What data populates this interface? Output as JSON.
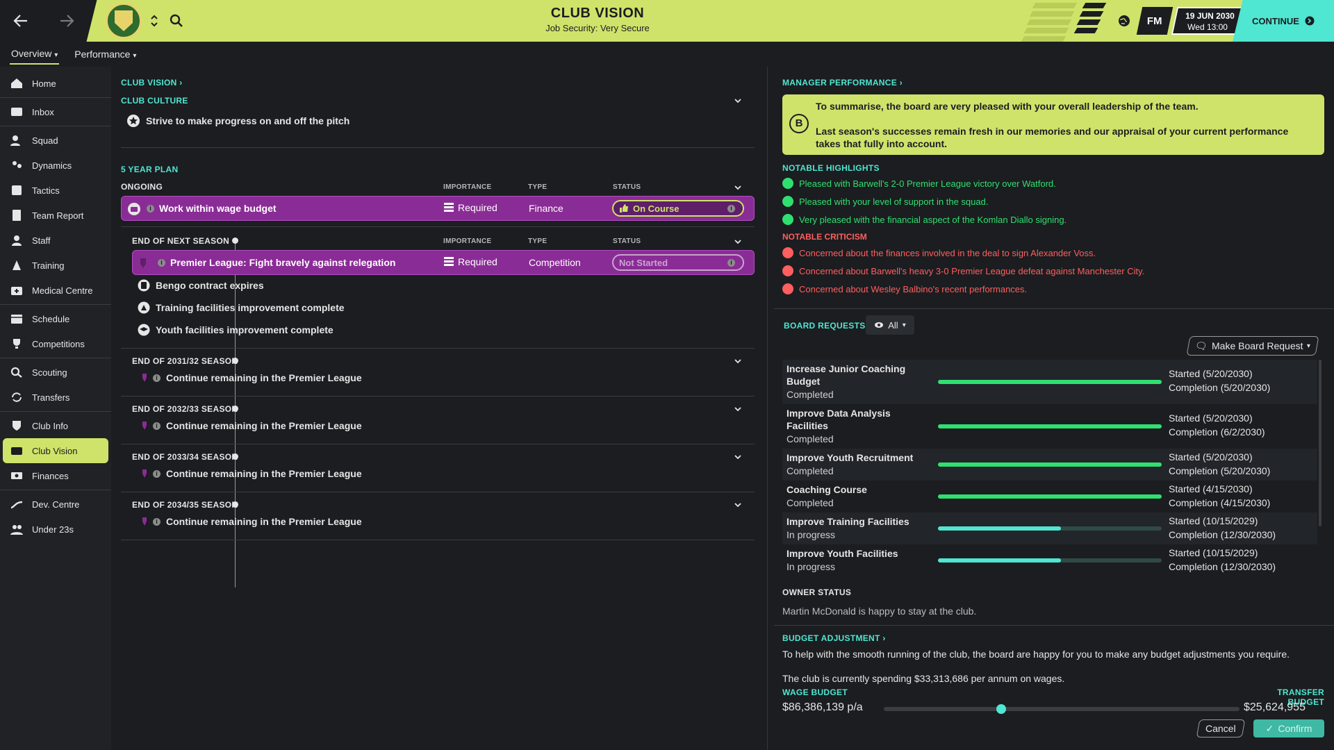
{
  "header": {
    "title": "CLUB VISION",
    "subtitle": "Job Security: Very Secure",
    "brand": "FM",
    "date": "19 JUN 2030",
    "time": "Wed 13:00",
    "continue_label": "CONTINUE"
  },
  "subnav": {
    "tabs": [
      {
        "label": "Overview"
      },
      {
        "label": "Performance"
      }
    ]
  },
  "sidebar": {
    "items": [
      {
        "label": "Home",
        "icon": "home-icon"
      },
      {
        "label": "Inbox",
        "icon": "inbox-icon"
      },
      {
        "label": "Squad",
        "icon": "squad-icon"
      },
      {
        "label": "Dynamics",
        "icon": "dynamics-icon"
      },
      {
        "label": "Tactics",
        "icon": "tactics-icon"
      },
      {
        "label": "Team Report",
        "icon": "report-icon"
      },
      {
        "label": "Staff",
        "icon": "staff-icon"
      },
      {
        "label": "Training",
        "icon": "training-icon"
      },
      {
        "label": "Medical Centre",
        "icon": "medical-icon"
      },
      {
        "label": "Schedule",
        "icon": "calendar-icon"
      },
      {
        "label": "Competitions",
        "icon": "trophy-icon"
      },
      {
        "label": "Scouting",
        "icon": "search-icon"
      },
      {
        "label": "Transfers",
        "icon": "transfer-icon"
      },
      {
        "label": "Club Info",
        "icon": "shield-icon"
      },
      {
        "label": "Club Vision",
        "icon": "vision-icon"
      },
      {
        "label": "Finances",
        "icon": "money-icon"
      },
      {
        "label": "Dev. Centre",
        "icon": "dev-icon"
      },
      {
        "label": "Under 23s",
        "icon": "u23-icon"
      }
    ]
  },
  "vision": {
    "link": "CLUB VISION",
    "culture_head": "CLUB CULTURE",
    "culture_item": "Strive to make progress on and off the pitch",
    "plan_head": "5 YEAR PLAN",
    "col_importance": "IMPORTANCE",
    "col_type": "TYPE",
    "col_status": "STATUS",
    "ongoing": {
      "head": "ONGOING",
      "goal": "Work within wage budget",
      "importance": "Required",
      "type": "Finance",
      "status": "On Course"
    },
    "next_season": {
      "head": "END OF NEXT SEASON",
      "goal": "Premier League: Fight bravely against relegation",
      "importance": "Required",
      "type": "Competition",
      "status": "Not Started",
      "tasks": [
        "Bengo contract expires",
        "Training facilities improvement complete",
        "Youth facilities improvement complete"
      ]
    },
    "seasons": [
      {
        "head": "END OF 2031/32 SEASON",
        "goal": "Continue remaining in the Premier League"
      },
      {
        "head": "END OF 2032/33 SEASON",
        "goal": "Continue remaining in the Premier League"
      },
      {
        "head": "END OF 2033/34 SEASON",
        "goal": "Continue remaining in the Premier League"
      },
      {
        "head": "END OF 2034/35 SEASON",
        "goal": "Continue remaining in the Premier League"
      }
    ]
  },
  "manager": {
    "link": "MANAGER PERFORMANCE",
    "grade": "B",
    "summary_1": "To summarise, the board are very pleased with your overall leadership of the team.",
    "summary_2": "Last season's successes remain fresh in our memories and our appraisal of your current performance",
    "summary_3": "takes that fully into account.",
    "highlights_head": "NOTABLE HIGHLIGHTS",
    "highlights": [
      "Pleased with Barwell's 2-0 Premier League victory over Watford.",
      "Pleased with your level of support in the squad.",
      "Very pleased with the financial aspect of the Komlan Diallo signing."
    ],
    "criticism_head": "NOTABLE CRITICISM",
    "criticism": [
      "Concerned about the finances involved in the deal to sign Alexander Voss.",
      "Concerned about Barwell's heavy 3-0 Premier League defeat against Manchester City.",
      "Concerned about Wesley Balbino's recent performances."
    ]
  },
  "board": {
    "head": "BOARD REQUESTS",
    "filter": "All",
    "make_request": "Make Board Request",
    "requests": [
      {
        "name": "Increase Junior Coaching Budget",
        "state": "Completed",
        "progress": 1.0,
        "started": "Started (5/20/2030)",
        "completion": "Completion (5/20/2030)"
      },
      {
        "name": "Improve Data Analysis Facilities",
        "state": "Completed",
        "progress": 1.0,
        "started": "Started (5/20/2030)",
        "completion": "Completion (6/2/2030)"
      },
      {
        "name": "Improve Youth Recruitment",
        "state": "Completed",
        "progress": 1.0,
        "started": "Started (5/20/2030)",
        "completion": "Completion (5/20/2030)"
      },
      {
        "name": "Coaching Course",
        "state": "Completed",
        "progress": 1.0,
        "started": "Started (4/15/2030)",
        "completion": "Completion (4/15/2030)"
      },
      {
        "name": "Improve Training Facilities",
        "state": "In progress",
        "progress": 0.55,
        "started": "Started (10/15/2029)",
        "completion": "Completion (12/30/2030)"
      },
      {
        "name": "Improve Youth Facilities",
        "state": "In progress",
        "progress": 0.55,
        "started": "Started (10/15/2029)",
        "completion": "Completion (12/30/2030)"
      }
    ]
  },
  "owner": {
    "head": "OWNER STATUS",
    "text": "Martin McDonald is happy to stay at the club."
  },
  "budget": {
    "link": "BUDGET ADJUSTMENT",
    "text_1": "To help with the smooth running of the club, the board are happy for you to make any budget adjustments you require.",
    "text_2": "The club is currently spending $33,313,686 per annum on wages.",
    "wage_head": "WAGE BUDGET",
    "wage_value": "$86,386,139 p/a",
    "transfer_head": "TRANSFER BUDGET",
    "transfer_value": "$25,624,955",
    "slider_fraction": 0.33,
    "cancel": "Cancel",
    "confirm": "Confirm"
  },
  "colors": {
    "accent": "#cfe36a",
    "teal": "#4fe6d2",
    "purple": "#8a2c96",
    "positive": "#2fe070",
    "negative": "#ff5f5f"
  }
}
